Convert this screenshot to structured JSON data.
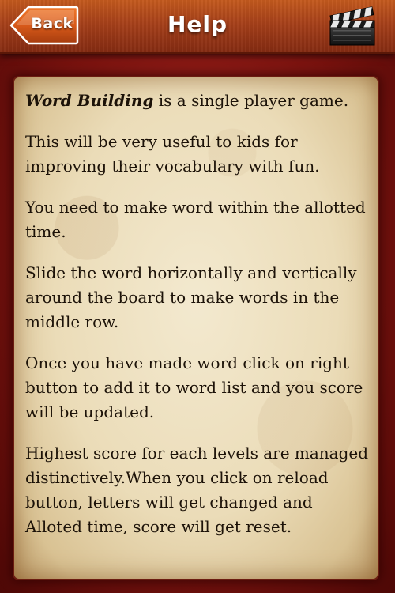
{
  "header": {
    "back_label": "Back",
    "title": "Help",
    "clapper_icon": "clapperboard-icon"
  },
  "help": {
    "game_name": "Word Building",
    "p1_rest": " is a single player game.",
    "p2": "This will be very useful to kids for improving their vocabulary with fun.",
    "p3": "You need to make word within the allotted time.",
    "p4": "Slide the word horizontally and vertically around the board to make words in the middle row.",
    "p5": "Once you have made word click on right button to add it to word list and you score will be updated.",
    "p6": "Highest score for each levels are managed distinctively.When you click on reload button, letters will get changed and Alloted time, score will get reset."
  },
  "colors": {
    "header_top": "#c45a1e",
    "header_bottom": "#842b12",
    "background": "#8b1a14",
    "parchment": "#ebdcb8",
    "text": "#1c1208"
  }
}
